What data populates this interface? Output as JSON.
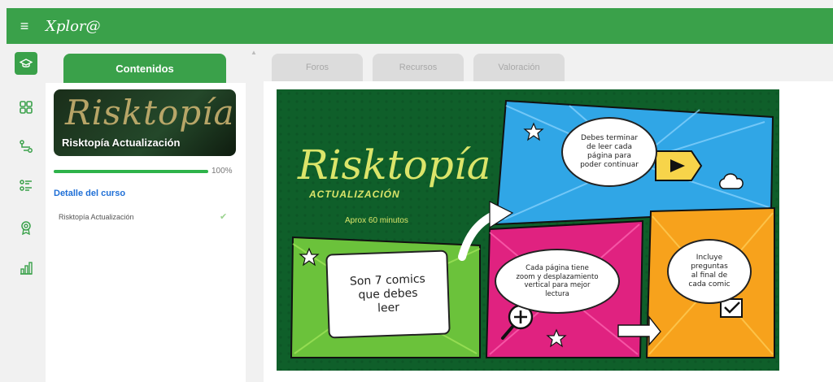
{
  "header": {
    "menu_icon": "hamburger-icon",
    "logo_text": "Xplor@",
    "bar_color": "#3aa14a"
  },
  "rail": {
    "items": [
      {
        "name": "graduation-cap-icon",
        "active": true
      },
      {
        "name": "grid-icon",
        "active": false
      },
      {
        "name": "route-icon",
        "active": false
      },
      {
        "name": "list-icon",
        "active": false
      },
      {
        "name": "badge-icon",
        "active": false
      },
      {
        "name": "chart-icon",
        "active": false
      }
    ]
  },
  "left_panel": {
    "tab_label": "Contenidos",
    "card": {
      "script_title": "Risktopía",
      "label": "Risktopía Actualización"
    },
    "progress": {
      "value": 1.0,
      "label": "100%"
    },
    "detail_title": "Detalle del curso",
    "items": [
      {
        "label": "Risktopía Actualización",
        "status": "check-icon"
      }
    ]
  },
  "tabs": [
    "Foros",
    "Recursos",
    "Valoración"
  ],
  "banner": {
    "title": "Risktopía",
    "subtitle": "ACTUALIZACIÓN",
    "duration": "Aprox 60 minutos",
    "bubble_a": [
      "Debes terminar",
      "de leer cada",
      "página para",
      "poder continuar"
    ],
    "bubble_b": [
      "Son 7 comics",
      "que debes",
      "leer"
    ],
    "bubble_c": [
      "Cada página tiene",
      "zoom y desplazamiento",
      "vertical para mejor",
      "lectura"
    ],
    "bubble_d": [
      "Incluye",
      "preguntas",
      "al final de",
      "cada comic"
    ]
  }
}
